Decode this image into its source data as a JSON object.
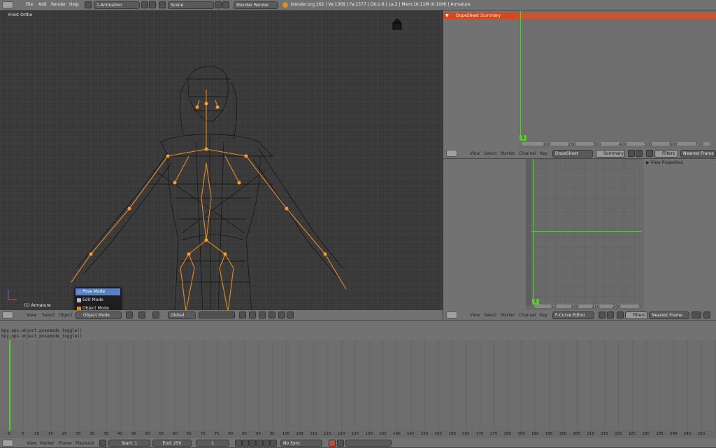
{
  "top_menu": [
    "File",
    "Add",
    "Render",
    "Help"
  ],
  "layout": {
    "name": "1-Animation"
  },
  "scene": {
    "name": "Scene"
  },
  "engine": "Blender Render",
  "stats": "blender.org 262 | Ve:1369 | Fa:2577 | Ob:1-8 | La:2 | Mem:10.11M (0.10M) | Armature",
  "viewport": {
    "view_label": "Front Ortho",
    "object_label": "(1) Armature",
    "menu": [
      "View",
      "Select",
      "Object"
    ],
    "mode": "Object Mode",
    "orientation": "Global",
    "mode_popup": {
      "items": [
        "Pose Mode",
        "Edit Mode",
        "Object Mode"
      ],
      "selected": "Pose Mode"
    }
  },
  "dopesheet": {
    "summary": "DopeSheet Summary",
    "current_frame": "1",
    "ticks": [
      "100",
      "200",
      "300",
      "400",
      "500",
      "600",
      "700"
    ],
    "menu": [
      "View",
      "Select",
      "Marker",
      "Channel",
      "Key"
    ],
    "mode": "DopeSheet",
    "summary_btn": "Summary",
    "filters": "Filters",
    "snap": "Nearest Frame"
  },
  "graph": {
    "view_properties": "View Properties",
    "current_frame": "1",
    "ticks": [
      "50",
      "100",
      "150",
      "200"
    ],
    "menu": [
      "View",
      "Select",
      "Marker",
      "Channel",
      "Key"
    ],
    "mode": "F-Curve Editor",
    "filters": "Filters",
    "snap": "Nearest Frame"
  },
  "console": {
    "lines": [
      "bpy.ops.object.posemode_toggle()",
      "bpy.ops.object.posemode_toggle()"
    ]
  },
  "timeline": {
    "ticks": [
      "0",
      "5",
      "10",
      "15",
      "20",
      "25",
      "30",
      "35",
      "40",
      "45",
      "50",
      "55",
      "60",
      "65",
      "70",
      "75",
      "80",
      "85",
      "90",
      "95",
      "100",
      "105",
      "110",
      "115",
      "120",
      "125",
      "130",
      "135",
      "140",
      "145",
      "150",
      "155",
      "160",
      "165",
      "170",
      "175",
      "180",
      "185",
      "190",
      "195",
      "200",
      "205",
      "210",
      "215",
      "220",
      "225",
      "230",
      "235",
      "240",
      "245",
      "250"
    ],
    "menu": [
      "View",
      "Marker",
      "Frame",
      "Playback"
    ],
    "start": "Start: 1",
    "end": "End: 250",
    "current": "1",
    "sync": "No Sync"
  },
  "colors": {
    "accent_orange": "#ff8a1a",
    "selection_blue": "#5680c2",
    "frame_green": "#5ec43a",
    "summary_red": "#d9461c"
  }
}
